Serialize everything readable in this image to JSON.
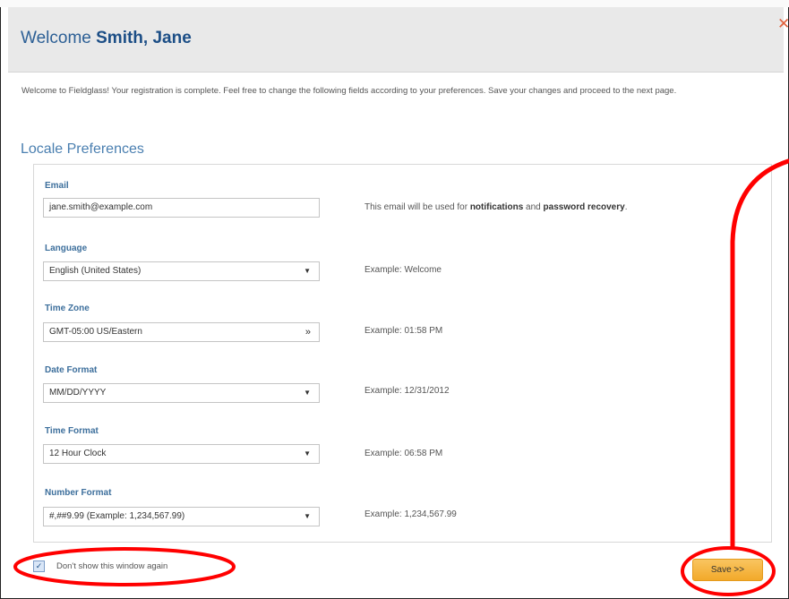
{
  "dialog": {
    "title_prefix": "Welcome",
    "user_name": "Smith, Jane",
    "close_glyph": "✕",
    "intro_text": "Welcome to Fieldglass! Your registration is complete. Feel free to change the following fields according to your preferences. Save your changes and proceed to the next page."
  },
  "section": {
    "title": "Locale Preferences"
  },
  "fields": {
    "email": {
      "label": "Email",
      "value": "jane.smith@example.com",
      "hint_pre": "This email will be used for ",
      "hint_b1": "notifications",
      "hint_mid": " and ",
      "hint_b2": "password recovery",
      "hint_post": "."
    },
    "language": {
      "label": "Language",
      "value": "English (United States)",
      "hint": "Example: Welcome"
    },
    "timezone": {
      "label": "Time Zone",
      "value": "GMT-05:00 US/Eastern",
      "hint": "Example: 01:58 PM"
    },
    "date_format": {
      "label": "Date Format",
      "value": "MM/DD/YYYY",
      "hint": "Example: 12/31/2012"
    },
    "time_format": {
      "label": "Time Format",
      "value": "12 Hour Clock",
      "hint": "Example: 06:58 PM"
    },
    "number_format": {
      "label": "Number Format",
      "value": "#,##9.99 (Example: 1,234,567.99)",
      "hint": "Example: 1,234,567.99"
    }
  },
  "footer": {
    "dont_show_label": "Don't show this window again",
    "dont_show_checked": true,
    "save_label": "Save >>"
  },
  "icons": {
    "dropdown": "chevron-down-icon",
    "timezone_dropdown": "double-chevron-icon"
  },
  "colors": {
    "accent_blue": "#2c5f95",
    "label_blue": "#3d6f9c",
    "close_orange": "#e0603b",
    "save_button": "#f2a92a",
    "annotation_red": "#ff0000"
  }
}
